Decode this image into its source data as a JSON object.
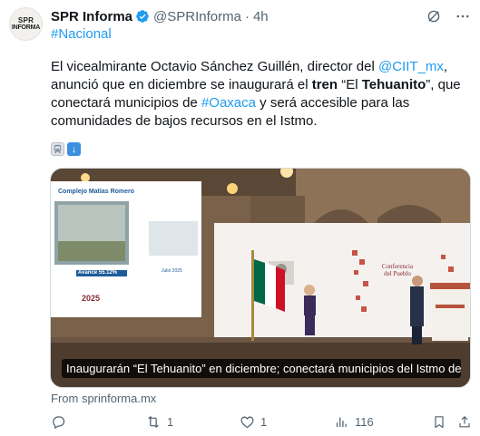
{
  "account": {
    "avatar_line1": "SPR",
    "avatar_line2": "INFORMA",
    "name": "SPR Informa",
    "handle": "@SPRInforma",
    "separator": "·",
    "time": "4h"
  },
  "hashtag": "#Nacional",
  "body": {
    "t1": "El vicealmirante Octavio Sánchez Guillén, director del ",
    "mention": "@CIIT_mx",
    "t2": ", anunció que en diciembre se inaugurará el ",
    "bold1": "tren",
    "t3": " “El ",
    "bold2": "Tehuanito",
    "t4": "”, que conectará municipios de ",
    "hashtag_oaxaca": "#Oaxaca",
    "t5": " y será accesible para las comunidades de bajos recursos en el Istmo."
  },
  "emojis": [
    "train-emoji",
    "down-arrow-emoji"
  ],
  "media": {
    "caption": "Inaugurarán “El Tehuanito” en diciembre; conectará municipios del Istmo de T...",
    "slide_title": "Complejo Matías Romero",
    "slide_progress": "Avance 55.12%",
    "slide_date": "Julio 2025",
    "slide_year": "2025",
    "backdrop_text": "Conferencia del Pueblo"
  },
  "source": "From sprinforma.mx",
  "actions": {
    "reply_count": "",
    "retweet_count": "1",
    "like_count": "1",
    "views_count": "116"
  },
  "colors": {
    "link": "#1d9bf0",
    "muted": "#536471",
    "verified": "#1d9bf0"
  }
}
